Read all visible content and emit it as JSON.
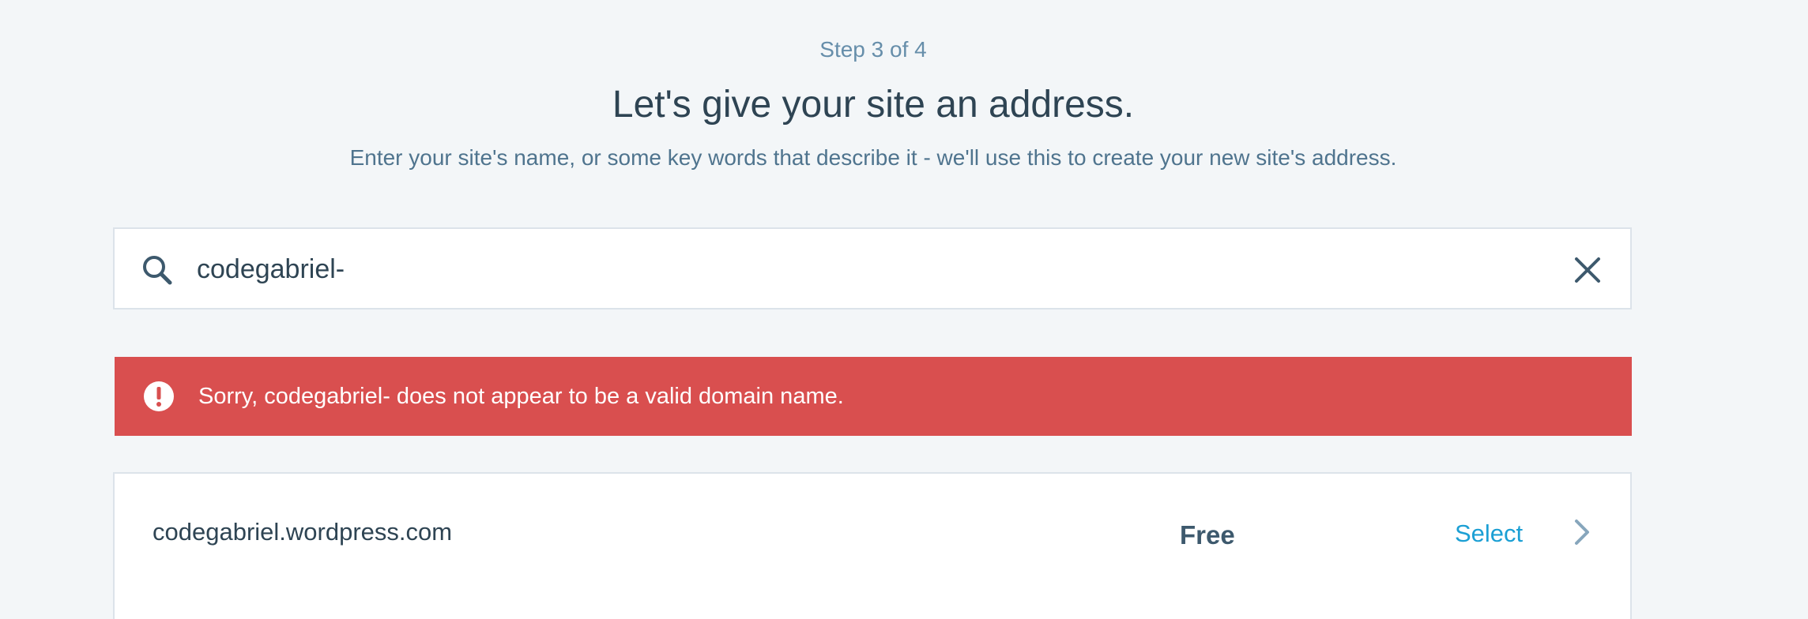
{
  "header": {
    "step": "Step 3 of 4",
    "title": "Let's give your site an address.",
    "subtitle": "Enter your site's name, or some key words that describe it - we'll use this to create your new site's address."
  },
  "search": {
    "value": "codegabriel-",
    "search_icon": "search-icon",
    "clear_icon": "close-icon"
  },
  "error": {
    "icon": "alert-icon",
    "message": "Sorry, codegabriel- does not appear to be a valid domain name."
  },
  "results": [
    {
      "domain": "codegabriel.wordpress.com",
      "price": "Free",
      "action": "Select",
      "icon": "chevron-right-icon"
    }
  ],
  "colors": {
    "background": "#f3f6f8",
    "error": "#d94f4f",
    "link": "#1b9fd4",
    "text": "#2e4453"
  }
}
